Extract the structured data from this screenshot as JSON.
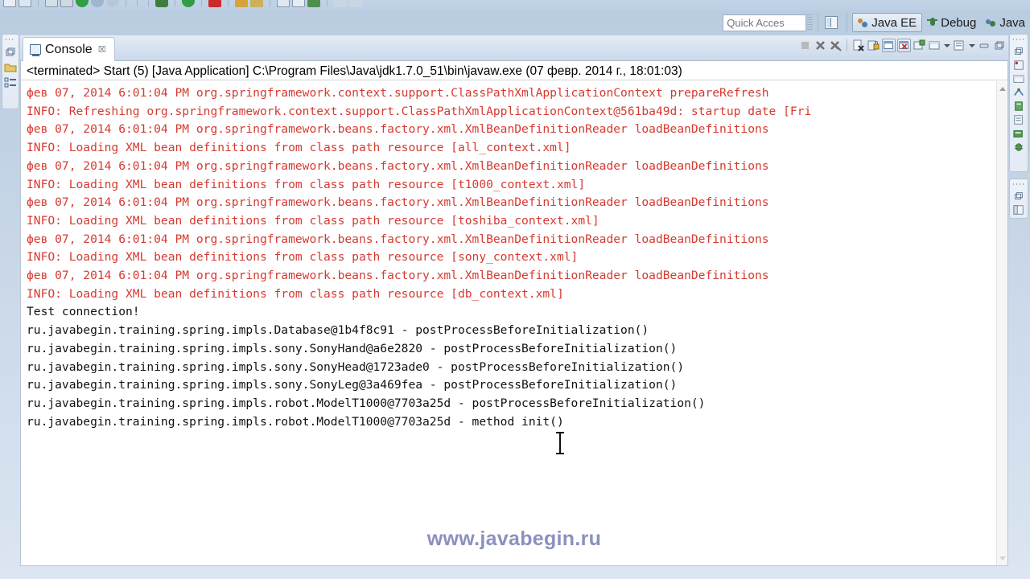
{
  "toolbar": {
    "icons": [
      "save-icon",
      "save-all-icon",
      "print-icon",
      "build-icon",
      "search-icon",
      "zoom-icon",
      "refresh-icon",
      "new-icon",
      "debug-icon",
      "run-icon",
      "stop-icon",
      "coverage-icon",
      "external-tools-icon",
      "folder-icon",
      "open-type-icon",
      "next-annotation-icon",
      "previous-annotation-icon",
      "last-edit-icon",
      "back-icon",
      "forward-icon"
    ]
  },
  "quick_access": {
    "value": "",
    "placeholder": "Quick Acces"
  },
  "perspectives": {
    "open_perspective_label": "open-perspective",
    "items": [
      {
        "label": "Java EE",
        "icon": "java-ee-perspective-icon",
        "active": true
      },
      {
        "label": "Debug",
        "icon": "debug-perspective-icon",
        "active": false
      },
      {
        "label": "Java",
        "icon": "java-perspective-icon",
        "active": false
      }
    ]
  },
  "left_rail": {
    "icons": [
      "restore-icon",
      "package-explorer-icon",
      "outline-icon"
    ]
  },
  "right_rail": {
    "group1": [
      "restore-icon",
      "problems-icon",
      "console-min-icon",
      "servers-icon",
      "data-source-explorer-icon",
      "snippets-icon",
      "properties-icon",
      "debug-min-icon"
    ],
    "group2": [
      "restore-icon",
      "outline-min-icon"
    ]
  },
  "view": {
    "tab": {
      "label": "Console",
      "icon": "console-icon",
      "close": "☒"
    },
    "toolbar_icons": [
      {
        "name": "terminate-icon",
        "boxed": false
      },
      {
        "name": "remove-launch-icon",
        "boxed": false
      },
      {
        "name": "remove-all-terminated-icon",
        "boxed": false
      },
      {
        "name": "separator",
        "boxed": false
      },
      {
        "name": "clear-console-icon",
        "boxed": false
      },
      {
        "name": "scroll-lock-icon",
        "boxed": false
      },
      {
        "name": "pin-console-icon",
        "boxed": true
      },
      {
        "name": "display-selected-console-icon",
        "boxed": true
      },
      {
        "name": "open-console-icon",
        "boxed": false
      },
      {
        "name": "new-console-view-icon",
        "boxed": false
      },
      {
        "name": "open-console-dropdown-icon",
        "boxed": false
      },
      {
        "name": "view-menu-icon",
        "boxed": false
      },
      {
        "name": "minimize-icon",
        "boxed": false
      },
      {
        "name": "maximize-icon",
        "boxed": false
      }
    ],
    "terminated_line": "<terminated> Start (5) [Java Application] C:\\Program Files\\Java\\jdk1.7.0_51\\bin\\javaw.exe (07 февр. 2014 г., 18:01:03)",
    "lines": [
      {
        "stream": "err",
        "text": "фев 07, 2014 6:01:04 PM org.springframework.context.support.ClassPathXmlApplicationContext prepareRefresh"
      },
      {
        "stream": "err",
        "text": "INFO: Refreshing org.springframework.context.support.ClassPathXmlApplicationContext@561ba49d: startup date [Fri"
      },
      {
        "stream": "err",
        "text": "фев 07, 2014 6:01:04 PM org.springframework.beans.factory.xml.XmlBeanDefinitionReader loadBeanDefinitions"
      },
      {
        "stream": "err",
        "text": "INFO: Loading XML bean definitions from class path resource [all_context.xml]"
      },
      {
        "stream": "err",
        "text": "фев 07, 2014 6:01:04 PM org.springframework.beans.factory.xml.XmlBeanDefinitionReader loadBeanDefinitions"
      },
      {
        "stream": "err",
        "text": "INFO: Loading XML bean definitions from class path resource [t1000_context.xml]"
      },
      {
        "stream": "err",
        "text": "фев 07, 2014 6:01:04 PM org.springframework.beans.factory.xml.XmlBeanDefinitionReader loadBeanDefinitions"
      },
      {
        "stream": "err",
        "text": "INFO: Loading XML bean definitions from class path resource [toshiba_context.xml]"
      },
      {
        "stream": "err",
        "text": "фев 07, 2014 6:01:04 PM org.springframework.beans.factory.xml.XmlBeanDefinitionReader loadBeanDefinitions"
      },
      {
        "stream": "err",
        "text": "INFO: Loading XML bean definitions from class path resource [sony_context.xml]"
      },
      {
        "stream": "err",
        "text": "фев 07, 2014 6:01:04 PM org.springframework.beans.factory.xml.XmlBeanDefinitionReader loadBeanDefinitions"
      },
      {
        "stream": "err",
        "text": "INFO: Loading XML bean definitions from class path resource [db_context.xml]"
      },
      {
        "stream": "out",
        "text": "Test connection!"
      },
      {
        "stream": "out",
        "text": "ru.javabegin.training.spring.impls.Database@1b4f8c91 - postProcessBeforeInitialization()"
      },
      {
        "stream": "out",
        "text": "ru.javabegin.training.spring.impls.sony.SonyHand@a6e2820 - postProcessBeforeInitialization()"
      },
      {
        "stream": "out",
        "text": "ru.javabegin.training.spring.impls.sony.SonyHead@1723ade0 - postProcessBeforeInitialization()"
      },
      {
        "stream": "out",
        "text": "ru.javabegin.training.spring.impls.sony.SonyLeg@3a469fea - postProcessBeforeInitialization()"
      },
      {
        "stream": "out",
        "text": "ru.javabegin.training.spring.impls.robot.ModelT1000@7703a25d - postProcessBeforeInitialization()"
      },
      {
        "stream": "out",
        "text": "ru.javabegin.training.spring.impls.robot.ModelT1000@7703a25d - method init()"
      }
    ]
  },
  "watermark": {
    "text": "www.javabegin.ru"
  },
  "colors": {
    "error_text": "#d63a30",
    "stdout_text": "#111111",
    "watermark": "#8b90bf",
    "chrome": "#c7d6e7"
  }
}
